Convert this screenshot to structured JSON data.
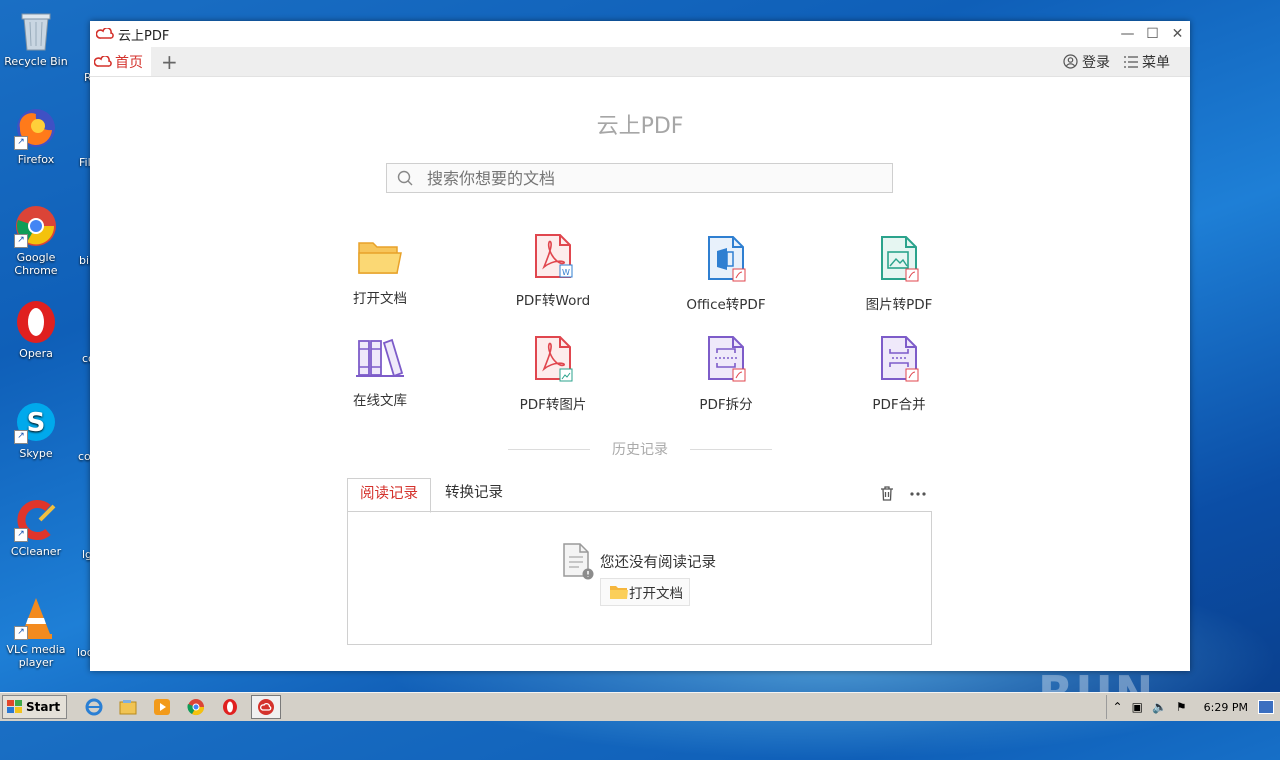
{
  "desktop": {
    "icons": [
      {
        "label": "Recycle Bin",
        "icon": "recycle-bin-icon"
      },
      {
        "label": "Firefox",
        "icon": "firefox-icon"
      },
      {
        "label": "Google Chrome",
        "icon": "chrome-icon"
      },
      {
        "label": "Opera",
        "icon": "opera-icon"
      },
      {
        "label": "Skype",
        "icon": "skype-icon"
      },
      {
        "label": "CCleaner",
        "icon": "ccleaner-icon"
      },
      {
        "label": "VLC media player",
        "icon": "vlc-icon"
      }
    ],
    "partial_labels": [
      "R",
      "Fil",
      "bil",
      "co",
      "co",
      "lg",
      "loc"
    ],
    "watermark": "ANY RUN"
  },
  "window": {
    "title": "云上PDF",
    "tab_home": "首页",
    "tab_add": "+",
    "login": "登录",
    "menu": "菜单",
    "app_title": "云上PDF",
    "search_placeholder": "搜索你想要的文档",
    "tools": [
      {
        "label": "打开文档",
        "icon": "folder-icon"
      },
      {
        "label": "PDF转Word",
        "icon": "pdf-to-word-icon"
      },
      {
        "label": "Office转PDF",
        "icon": "office-to-pdf-icon"
      },
      {
        "label": "图片转PDF",
        "icon": "image-to-pdf-icon"
      },
      {
        "label": "在线文库",
        "icon": "library-icon"
      },
      {
        "label": "PDF转图片",
        "icon": "pdf-to-image-icon"
      },
      {
        "label": "PDF拆分",
        "icon": "pdf-split-icon"
      },
      {
        "label": "PDF合并",
        "icon": "pdf-merge-icon"
      }
    ],
    "history_title": "历史记录",
    "record_tabs": [
      "阅读记录",
      "转换记录"
    ],
    "empty_text": "您还没有阅读记录",
    "open_doc_button": "打开文档"
  },
  "taskbar": {
    "start": "Start",
    "clock": "6:29 PM"
  },
  "colors": {
    "accent": "#d4322c",
    "pdf_red": "#e0464e",
    "office_blue": "#2f7fd1",
    "image_green": "#2ba38c",
    "purple": "#7d5cc9",
    "folder_yellow": "#f5b63c"
  }
}
